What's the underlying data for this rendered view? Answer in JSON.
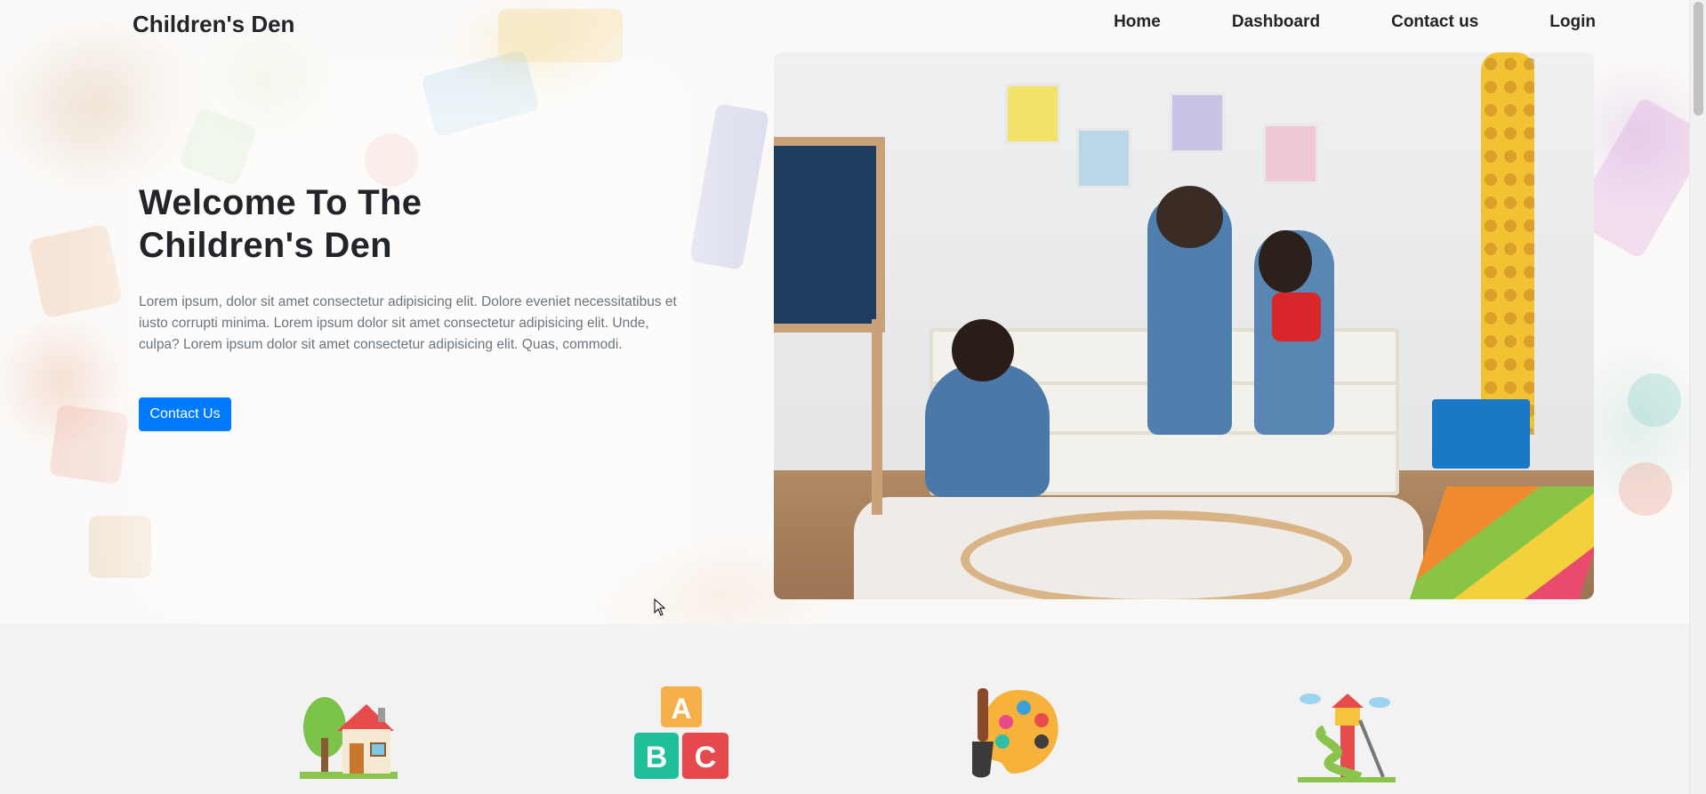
{
  "nav": {
    "brand": "Children's Den",
    "links": [
      "Home",
      "Dashboard",
      "Contact us",
      "Login"
    ]
  },
  "hero": {
    "title_line1": "Welcome To The",
    "title_line2": "Children's Den",
    "description": "Lorem ipsum, dolor sit amet consectetur adipisicing elit. Dolore eveniet necessitatibus et iusto corrupti minima. Lorem ipsum dolor sit amet consectetur adipisicing elit. Unde, culpa? Lorem ipsum dolor sit amet consectetur adipisicing elit. Quas, commodi.",
    "button_label": "Contact Us",
    "image_icon": "children-playroom-photo"
  },
  "features": {
    "icons": [
      "house-tree-icon",
      "abc-blocks-icon",
      "paint-palette-icon",
      "playground-slide-icon"
    ]
  },
  "colors": {
    "primary": "#007bff",
    "text": "#212529",
    "muted": "#6c757d",
    "section_bg": "#f2f2f2"
  }
}
